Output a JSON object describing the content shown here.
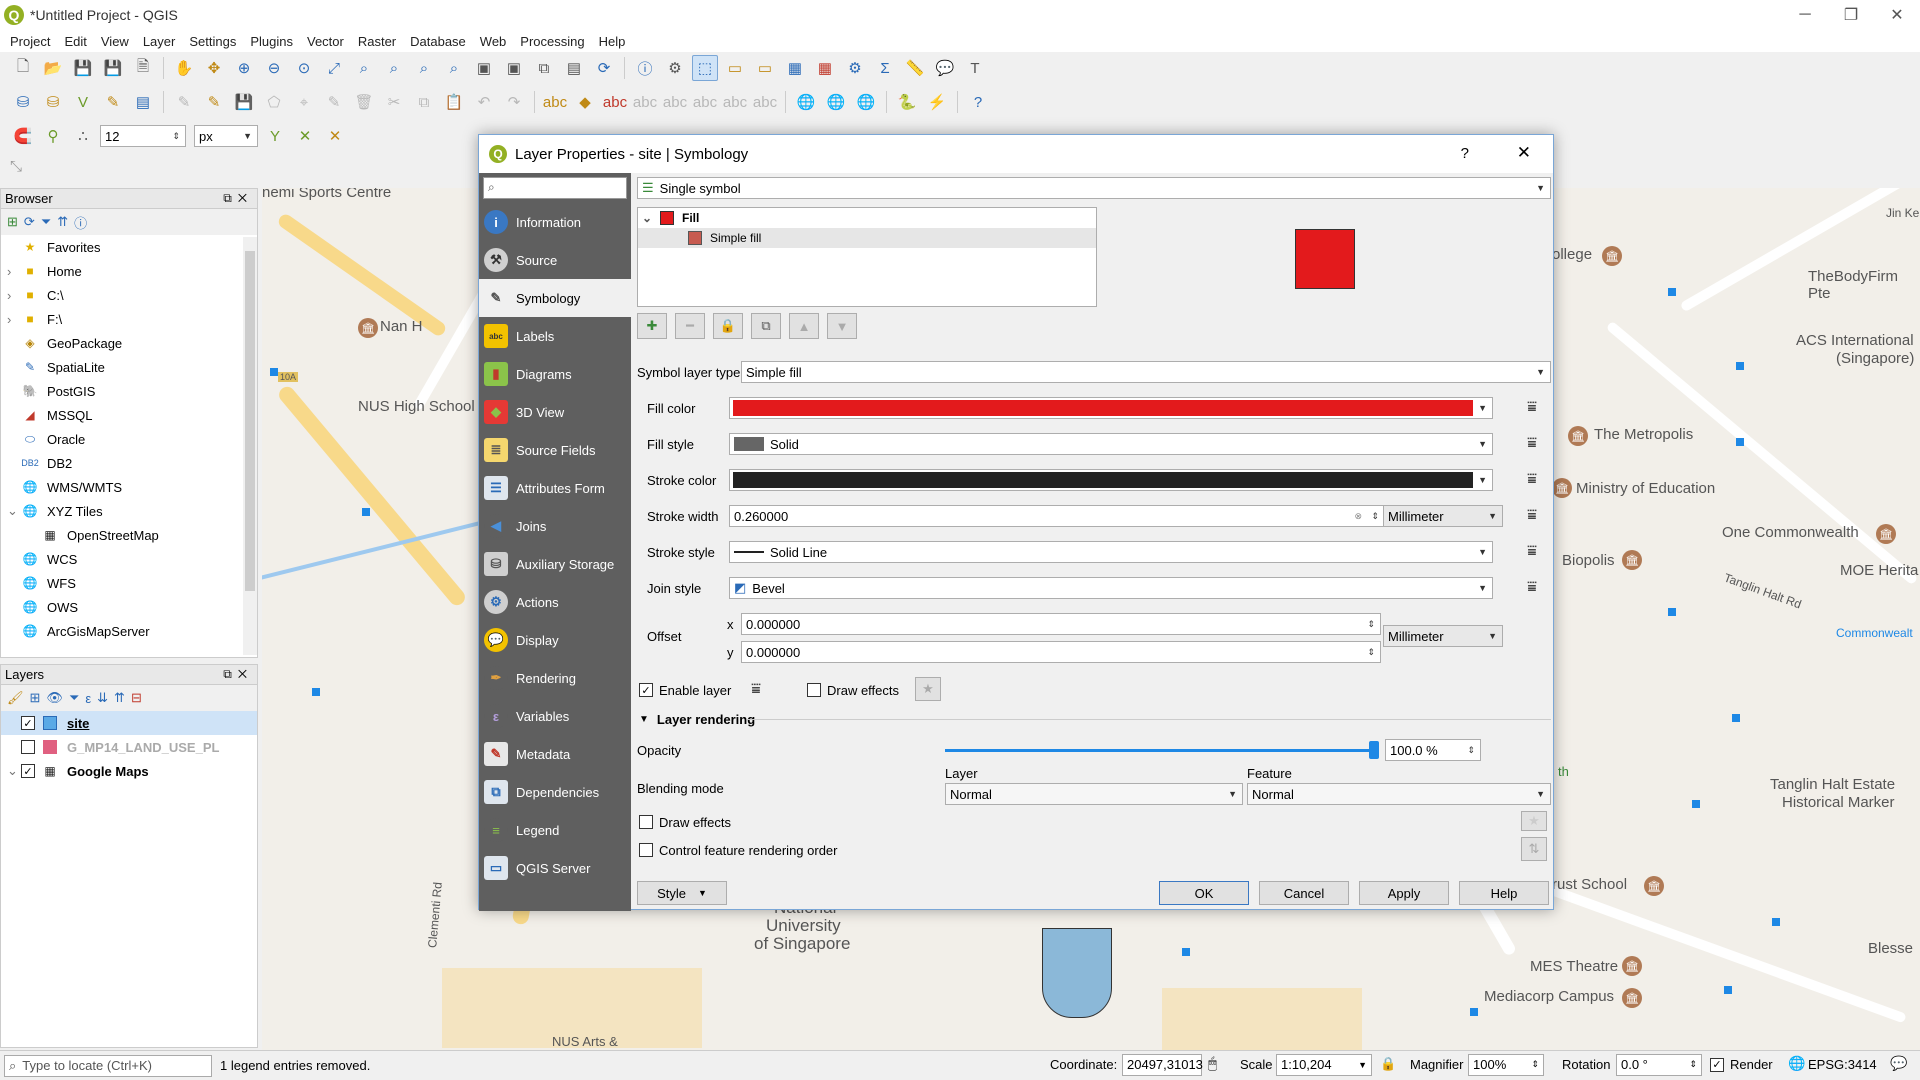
{
  "window": {
    "title": "*Untitled Project - QGIS",
    "controls": [
      "─",
      "❐",
      "✕"
    ]
  },
  "menu": [
    "Project",
    "Edit",
    "View",
    "Layer",
    "Settings",
    "Plugins",
    "Vector",
    "Raster",
    "Database",
    "Web",
    "Processing",
    "Help"
  ],
  "snap": {
    "value": "12",
    "unit": "px"
  },
  "browser": {
    "title": "Browser",
    "items": [
      {
        "label": "Favorites",
        "icon": "star-icon",
        "exp": ""
      },
      {
        "label": "Home",
        "icon": "folder-icon",
        "exp": "›"
      },
      {
        "label": "C:\\",
        "icon": "folder-icon",
        "exp": "›"
      },
      {
        "label": "F:\\",
        "icon": "folder-icon",
        "exp": "›"
      },
      {
        "label": "GeoPackage",
        "icon": "geopackage-icon",
        "exp": ""
      },
      {
        "label": "SpatiaLite",
        "icon": "spatialite-icon",
        "exp": ""
      },
      {
        "label": "PostGIS",
        "icon": "postgis-icon",
        "exp": ""
      },
      {
        "label": "MSSQL",
        "icon": "mssql-icon",
        "exp": ""
      },
      {
        "label": "Oracle",
        "icon": "oracle-icon",
        "exp": ""
      },
      {
        "label": "DB2",
        "icon": "db2-icon",
        "exp": ""
      },
      {
        "label": "WMS/WMTS",
        "icon": "globe-icon",
        "exp": ""
      },
      {
        "label": "XYZ Tiles",
        "icon": "globe-icon",
        "exp": "⌄"
      },
      {
        "label": "OpenStreetMap",
        "icon": "grid-icon",
        "exp": ""
      },
      {
        "label": "WCS",
        "icon": "globe-icon",
        "exp": ""
      },
      {
        "label": "WFS",
        "icon": "globe-icon",
        "exp": ""
      },
      {
        "label": "OWS",
        "icon": "globe-icon",
        "exp": ""
      },
      {
        "label": "ArcGisMapServer",
        "icon": "globe-icon",
        "exp": ""
      }
    ]
  },
  "layers": {
    "title": "Layers",
    "items": [
      {
        "label": "site",
        "checked": "✓",
        "color": "#5aa9e6",
        "style": "bold"
      },
      {
        "label": "G_MP14_LAND_USE_PL",
        "checked": "",
        "color": "#e06080",
        "style": "dim"
      },
      {
        "label": "Google Maps",
        "checked": "✓",
        "color": "#333333",
        "style": "bold"
      }
    ]
  },
  "map_labels": {
    "sports": "nemi Sports Centre",
    "nan": "Nan H",
    "nus_high": "NUS High School",
    "ollege": "ollege",
    "bodyfirm": "TheBodyFirm Pte",
    "acs": "ACS International",
    "acs2": "(Singapore)",
    "metropolis": "The Metropolis",
    "moe_ministry": "Ministry of Education",
    "commonwealth": "One Commonwealth",
    "biopolis": "Biopolis",
    "moe_herit": "MOE Herita",
    "commonwealth2": "Commonwealt",
    "tanglin": "Tanglin Halt Estate",
    "tanglin2": "Historical Marker",
    "trust": "rust School",
    "nus1": "National",
    "nus2": "University",
    "nus3": "of Singapore",
    "mes": "MES Theatre",
    "mediacorp": "Mediacorp Campus",
    "blessed": "Blesse",
    "jin": "Jin Ke",
    "tanglin_rd": "Tanglin Halt Rd",
    "clementi": "Clementi Rd",
    "nus_arts": "NUS Arts &",
    "tag": "10A",
    "th": "th"
  },
  "dialog": {
    "title": "Layer Properties - site | Symbology",
    "help": "?",
    "close": "✕",
    "sidebar": [
      {
        "label": "Information",
        "icon": "i",
        "bg": "#3a78c3",
        "name": "information-icon"
      },
      {
        "label": "Source",
        "icon": "⚒",
        "bg": "#d0d0d0",
        "name": "source-icon"
      },
      {
        "label": "Symbology",
        "icon": "✎",
        "bg": "#f0f0f0",
        "name": "symbology-icon"
      },
      {
        "label": "Labels",
        "icon": "abc",
        "bg": "#f2c200",
        "name": "labels-icon"
      },
      {
        "label": "Diagrams",
        "icon": "▮",
        "bg": "#8bc34a",
        "name": "diagrams-icon"
      },
      {
        "label": "3D View",
        "icon": "◆",
        "bg": "#e53935",
        "name": "3d-view-icon"
      },
      {
        "label": "Source Fields",
        "icon": "≣",
        "bg": "#f5d76e",
        "name": "source-fields-icon"
      },
      {
        "label": "Attributes Form",
        "icon": "☰",
        "bg": "#dfe6ee",
        "name": "attributes-form-icon"
      },
      {
        "label": "Joins",
        "icon": "◀",
        "bg": "#4a90d9",
        "name": "joins-icon"
      },
      {
        "label": "Auxiliary Storage",
        "icon": "⛁",
        "bg": "#cfcfcf",
        "name": "auxiliary-storage-icon"
      },
      {
        "label": "Actions",
        "icon": "⚙",
        "bg": "#cfcfcf",
        "name": "actions-icon"
      },
      {
        "label": "Display",
        "icon": "💬",
        "bg": "#f2c200",
        "name": "display-icon"
      },
      {
        "label": "Rendering",
        "icon": "✒",
        "bg": "#e0a040",
        "name": "rendering-icon"
      },
      {
        "label": "Variables",
        "icon": "ε",
        "bg": "#7a5fa8",
        "name": "variables-icon"
      },
      {
        "label": "Metadata",
        "icon": "✎",
        "bg": "#e8e8e8",
        "name": "metadata-icon"
      },
      {
        "label": "Dependencies",
        "icon": "⧉",
        "bg": "#dfe6ee",
        "name": "dependencies-icon"
      },
      {
        "label": "Legend",
        "icon": "≡",
        "bg": "#8bc34a",
        "name": "legend-icon"
      },
      {
        "label": "QGIS Server",
        "icon": "▭",
        "bg": "#dfe6ee",
        "name": "qgis-server-icon"
      }
    ],
    "renderer": "Single symbol",
    "tree": {
      "fill": "Fill",
      "simple_fill": "Simple fill"
    },
    "symbol_layer_type_label": "Symbol layer type",
    "symbol_layer_type": "Simple fill",
    "fill_color_label": "Fill color",
    "fill_color": "#e31a1c",
    "fill_style_label": "Fill style",
    "fill_style": "Solid",
    "stroke_color_label": "Stroke color",
    "stroke_color": "#232323",
    "stroke_width_label": "Stroke width",
    "stroke_width": "0.260000",
    "unit": "Millimeter",
    "stroke_style_label": "Stroke style",
    "stroke_style": "Solid Line",
    "join_style_label": "Join style",
    "join_style": "Bevel",
    "offset_label": "Offset",
    "offset_x_label": "x",
    "offset_x": "0.000000",
    "offset_y_label": "y",
    "offset_y": "0.000000",
    "offset_unit": "Millimeter",
    "enable_layer": "Enable layer",
    "draw_effects": "Draw effects",
    "layer_rendering": "Layer rendering",
    "opacity_label": "Opacity",
    "opacity": "100.0 %",
    "opacity_level": 1.0,
    "blending_label": "Blending mode",
    "layer_label": "Layer",
    "feature_label": "Feature",
    "blend_layer": "Normal",
    "blend_feature": "Normal",
    "draw_effects2": "Draw effects",
    "control_order": "Control feature rendering order",
    "style_btn": "Style",
    "ok": "OK",
    "cancel": "Cancel",
    "apply": "Apply",
    "help_btn": "Help"
  },
  "status": {
    "locate_placeholder": "Type to locate (Ctrl+K)",
    "message": "1 legend entries removed.",
    "coordinate_label": "Coordinate",
    "coordinate": "20497,31013",
    "scale_label": "Scale",
    "scale": "1:10,204",
    "magnifier_label": "Magnifier",
    "magnifier": "100%",
    "rotation_label": "Rotation",
    "rotation": "0.0 °",
    "render": "Render",
    "crs": "EPSG:3414"
  }
}
